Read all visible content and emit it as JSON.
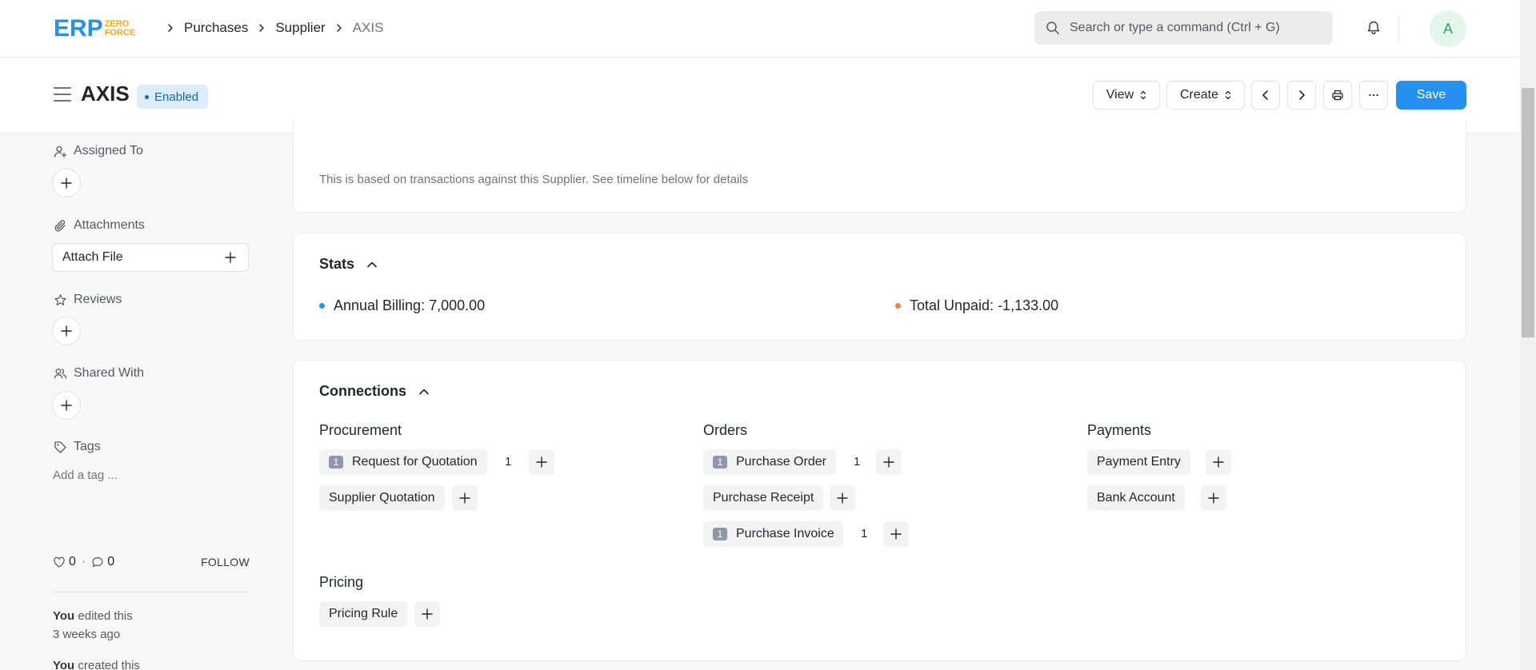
{
  "logo": {
    "text": "ERP",
    "line1": "ZERO",
    "line2": "FORCE"
  },
  "breadcrumbs": [
    "Purchases",
    "Supplier",
    "AXIS"
  ],
  "search": {
    "placeholder": "Search or type a command (Ctrl + G)"
  },
  "user": {
    "initial": "A"
  },
  "page": {
    "title": "AXIS",
    "status": "Enabled",
    "actions": {
      "view": "View",
      "create": "Create",
      "save": "Save"
    }
  },
  "sidebar": {
    "assigned_to": "Assigned To",
    "attachments": "Attachments",
    "attach_file": "Attach File",
    "reviews": "Reviews",
    "shared_with": "Shared With",
    "tags": "Tags",
    "add_tag": "Add a tag ...",
    "likes": "0",
    "comments": "0",
    "follow": "FOLLOW",
    "activity": [
      {
        "who": "You",
        "what": "edited this",
        "when": "3 weeks ago"
      },
      {
        "who": "You",
        "what": "created this",
        "when": ""
      }
    ]
  },
  "dashboard_note": "This is based on transactions against this Supplier. See timeline below for details",
  "stats": {
    "title": "Stats",
    "items": [
      {
        "label": "Annual Billing: 7,000.00",
        "color": "#2490ef"
      },
      {
        "label": "Total Unpaid: -1,133.00",
        "color": "#fa7c45"
      }
    ]
  },
  "connections": {
    "title": "Connections",
    "groups": [
      {
        "title": "Procurement",
        "items": [
          {
            "label": "Request for Quotation",
            "badge": "1",
            "count": "1"
          },
          {
            "label": "Supplier Quotation",
            "badge": "",
            "count": ""
          }
        ]
      },
      {
        "title": "Orders",
        "items": [
          {
            "label": "Purchase Order",
            "badge": "1",
            "count": "1"
          },
          {
            "label": "Purchase Receipt",
            "badge": "",
            "count": ""
          },
          {
            "label": "Purchase Invoice",
            "badge": "1",
            "count": "1"
          }
        ]
      },
      {
        "title": "Payments",
        "items": [
          {
            "label": "Payment Entry",
            "badge": "",
            "count": ""
          },
          {
            "label": "Bank Account",
            "badge": "",
            "count": ""
          }
        ]
      },
      {
        "title": "Pricing",
        "items": [
          {
            "label": "Pricing Rule",
            "badge": "",
            "count": ""
          }
        ]
      }
    ]
  }
}
